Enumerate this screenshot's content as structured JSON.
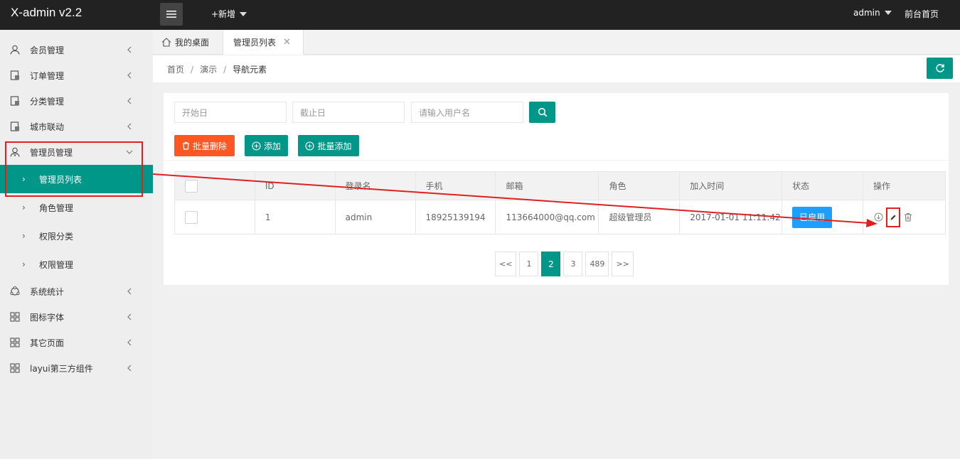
{
  "app": {
    "title": "X-admin v2.2"
  },
  "topbar": {
    "add_new": "+新增",
    "user": "admin",
    "front_link": "前台首页"
  },
  "sidebar": {
    "items": [
      {
        "label": "会员管理",
        "icon": "user-icon"
      },
      {
        "label": "订单管理",
        "icon": "order-icon"
      },
      {
        "label": "分类管理",
        "icon": "category-icon"
      },
      {
        "label": "城市联动",
        "icon": "city-icon"
      },
      {
        "label": "管理员管理",
        "icon": "admin-icon",
        "expanded": true
      },
      {
        "label": "系统统计",
        "icon": "stats-icon"
      },
      {
        "label": "图标字体",
        "icon": "grid-icon"
      },
      {
        "label": "其它页面",
        "icon": "grid-icon"
      },
      {
        "label": "layui第三方组件",
        "icon": "grid-icon"
      }
    ],
    "sub_items": [
      {
        "label": "管理员列表",
        "active": true
      },
      {
        "label": "角色管理"
      },
      {
        "label": "权限分类"
      },
      {
        "label": "权限管理"
      }
    ]
  },
  "tabs": {
    "home": "我的桌面",
    "active": "管理员列表"
  },
  "breadcrumb": [
    "首页",
    "演示",
    "导航元素"
  ],
  "filters": {
    "start_placeholder": "开始日",
    "end_placeholder": "截止日",
    "user_placeholder": "请输入用户名"
  },
  "buttons": {
    "batch_delete": "批量删除",
    "add": "添加",
    "batch_add": "批量添加"
  },
  "table": {
    "headers": [
      "ID",
      "登录名",
      "手机",
      "邮箱",
      "角色",
      "加入时间",
      "状态",
      "操作"
    ],
    "rows": [
      {
        "id": "1",
        "login": "admin",
        "phone": "18925139194",
        "email": "113664000@qq.com",
        "role": "超级管理员",
        "joined": "2017-01-01 11:11:42",
        "status": "已启用"
      }
    ]
  },
  "pagination": [
    "<<",
    "1",
    "2",
    "3",
    "489",
    ">>"
  ],
  "pagination_current": "2",
  "colors": {
    "accent": "#009688",
    "danger": "#FF5722",
    "info": "#1E9FFF",
    "annotation": "#e02020",
    "topbar": "#222222"
  }
}
